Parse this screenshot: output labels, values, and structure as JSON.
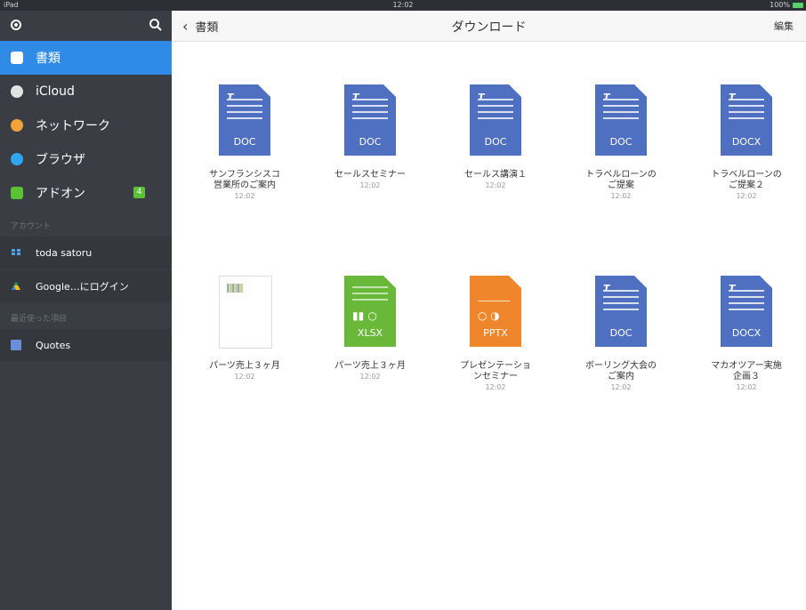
{
  "statusbar": {
    "carrier": "iPad",
    "time": "12:02",
    "battery": "100%"
  },
  "sidebar": {
    "nav": [
      {
        "label": "書類",
        "icon": "document-icon",
        "color": "#5da1f2",
        "selected": true
      },
      {
        "label": "iCloud",
        "icon": "cloud-icon",
        "color": "#e3e3e3"
      },
      {
        "label": "ネットワーク",
        "icon": "network-icon",
        "color": "#f2a23a"
      },
      {
        "label": "ブラウザ",
        "icon": "compass-icon",
        "color": "#2fa6f2"
      },
      {
        "label": "アドオン",
        "icon": "plus-icon",
        "color": "#5bc236",
        "badge": "4"
      }
    ],
    "accounts_header": "アカウント",
    "accounts": [
      {
        "label": "toda satoru",
        "icon": "dropbox-icon"
      },
      {
        "label": "Google…にログイン",
        "icon": "google-drive-icon"
      }
    ],
    "recent_header": "最近使った項目",
    "recent": [
      {
        "label": "Quotes",
        "icon": "document-icon"
      }
    ]
  },
  "topbar": {
    "back_label": "書類",
    "title": "ダウンロード",
    "edit_label": "編集"
  },
  "files": [
    {
      "line1": "サンフランシスコ",
      "line2": "営業所のご案内",
      "time": "12:02",
      "ext": "DOC",
      "kind": "word"
    },
    {
      "line1": "セールスセミナー",
      "line2": "",
      "time": "12:02",
      "ext": "DOC",
      "kind": "word"
    },
    {
      "line1": "セールス講演１",
      "line2": "",
      "time": "12:02",
      "ext": "DOC",
      "kind": "word"
    },
    {
      "line1": "トラベルローンの",
      "line2": "ご提案",
      "time": "12:02",
      "ext": "DOC",
      "kind": "word"
    },
    {
      "line1": "トラベルローンの",
      "line2": "ご提案２",
      "time": "12:02",
      "ext": "DOCX",
      "kind": "word"
    },
    {
      "line1": "パーツ売上３ヶ月",
      "line2": "",
      "time": "12:02",
      "ext": "",
      "kind": "thumb"
    },
    {
      "line1": "パーツ売上３ヶ月",
      "line2": "",
      "time": "12:02",
      "ext": "XLSX",
      "kind": "excel"
    },
    {
      "line1": "プレゼンテーショ",
      "line2": "ンセミナー",
      "time": "12:02",
      "ext": "PPTX",
      "kind": "ppt"
    },
    {
      "line1": "ボーリング大会の",
      "line2": "ご案内",
      "time": "12:02",
      "ext": "DOC",
      "kind": "word"
    },
    {
      "line1": "マカオツアー実施",
      "line2": "企画３",
      "time": "12:02",
      "ext": "DOCX",
      "kind": "word"
    }
  ],
  "colors": {
    "word": "#4f6fc0",
    "excel": "#69b83a",
    "ppt": "#f0862c",
    "selected": "#2f8be6",
    "sidebar": "#3a3e44"
  }
}
